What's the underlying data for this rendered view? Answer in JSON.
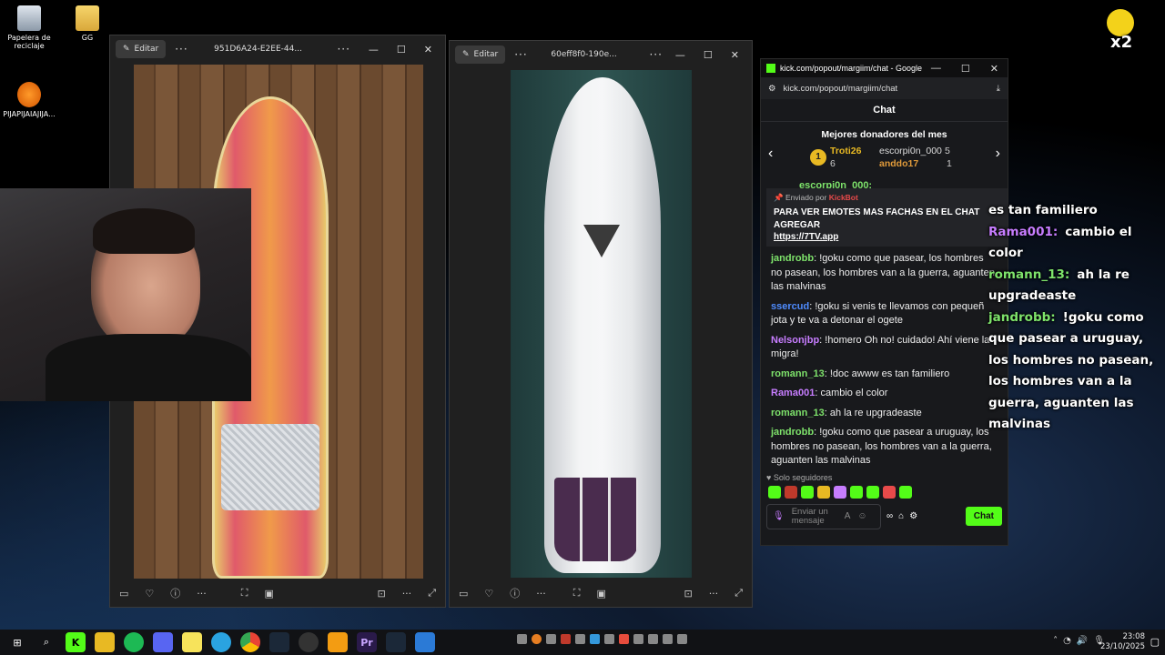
{
  "desktop": {
    "icons": [
      {
        "label": "Papelera de reciclaje"
      },
      {
        "label": "GG"
      },
      {
        "label": "PIJAPIJAIAJIJA..."
      }
    ],
    "multiplier": "x2"
  },
  "viewer_left": {
    "edit_label": "Editar",
    "title": "951D6A24-E2EE-44..."
  },
  "viewer_right": {
    "edit_label": "Editar",
    "title": "60eff8f0-190e..."
  },
  "browser": {
    "window_title": "kick.com/popout/margiim/chat - Google Ch...",
    "url": "kick.com/popout/margiim/chat"
  },
  "chat": {
    "header": "Chat",
    "top_donors_title": "Mejores donadores del mes",
    "donors": [
      {
        "rank": "1",
        "name": "Troti26",
        "amount": "6"
      },
      {
        "name": "escorpi0n_000",
        "amount": "5"
      },
      {
        "name": "anddo17",
        "amount": "1"
      }
    ],
    "partial_user": "escorpi0n_000:",
    "pinned": {
      "sent_by": "Enviado por",
      "bot": "KickBot",
      "text": "PARA VER EMOTES MAS FACHAS EN EL CHAT AGREGAR",
      "link": "https://7TV.app"
    },
    "messages": [
      {
        "user": "jandrobb",
        "text": "!goku como que pasear, los hombres no pasean, los hombres van a la guerra, aguanten las malvinas",
        "color": "#7ee36b"
      },
      {
        "user": "ssercud",
        "text": "!goku si venis te llevamos con pequeñ jota y te va a detonar el ogete",
        "color": "#4f8cff"
      },
      {
        "user": "Nelsonjbp",
        "text": "!homero Oh no! cuidado! Ahí viene la migra!",
        "color": "#c77dff"
      },
      {
        "user": "romann_13",
        "text": "!doc awww es tan familiero",
        "color": "#7ee36b"
      },
      {
        "user": "Rama001",
        "text": "cambio el color",
        "color": "#c77dff"
      },
      {
        "user": "romann_13",
        "text": "ah la re upgradeaste",
        "color": "#7ee36b"
      },
      {
        "user": "jandrobb",
        "text": "!goku como que pasear a uruguay, los hombres no pasean, los hombres van a la guerra, aguanten las malvinas",
        "color": "#7ee36b"
      }
    ],
    "followers_only": "Solo seguidores",
    "input_placeholder": "Enviar un mensaje",
    "send_label": "Chat"
  },
  "overlay": [
    {
      "user": "",
      "text": "es tan familiero"
    },
    {
      "user": "Rama001:",
      "text": "cambio el color",
      "color": "#c77dff"
    },
    {
      "user": "romann_13:",
      "text": "ah la re upgradeaste",
      "color": "#7ee36b"
    },
    {
      "user": "jandrobb:",
      "text": "!goku como que pasear a uruguay, los hombres no pasean, los hombres van a la guerra, aguanten las malvinas",
      "color": "#7ee36b"
    }
  ],
  "taskbar": {
    "time": "23:08",
    "date": "23/10/2025"
  }
}
